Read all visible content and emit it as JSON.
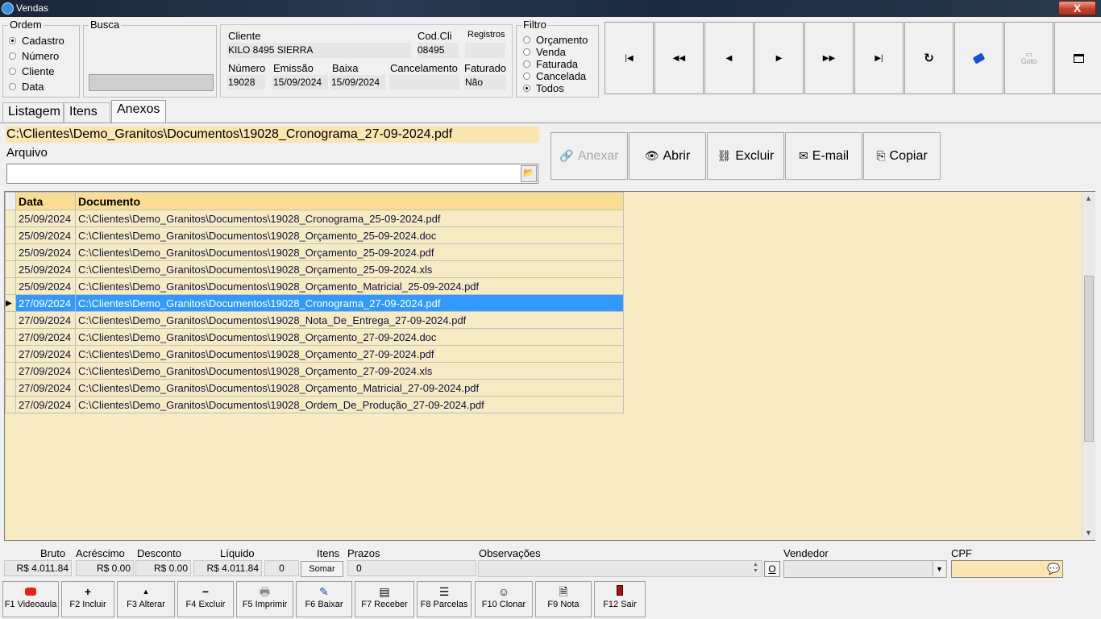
{
  "window": {
    "title": "Vendas",
    "close_label": "X"
  },
  "ordem": {
    "legend": "Ordem",
    "options": [
      {
        "label": "Cadastro",
        "checked": true
      },
      {
        "label": "Número",
        "checked": false
      },
      {
        "label": "Cliente",
        "checked": false
      },
      {
        "label": "Data",
        "checked": false
      }
    ]
  },
  "busca": {
    "legend": "Busca",
    "value": ""
  },
  "header": {
    "cliente_label": "Cliente",
    "cliente_value": "KILO 8495 SIERRA",
    "codcli_label": "Cod.Cli",
    "codcli_value": "08495",
    "registros_label": "Registros",
    "registros_value": "",
    "numero_label": "Número",
    "numero_value": "19028",
    "emissao_label": "Emissão",
    "emissao_value": "15/09/2024",
    "baixa_label": "Baixa",
    "baixa_value": "15/09/2024",
    "cancelamento_label": "Cancelamento",
    "cancelamento_value": "",
    "faturado_label": "Faturado",
    "faturado_value": "Não"
  },
  "filtro": {
    "legend": "Filtro",
    "options": [
      {
        "label": "Orçamento",
        "checked": false
      },
      {
        "label": "Venda",
        "checked": false
      },
      {
        "label": "Faturada",
        "checked": false
      },
      {
        "label": "Cancelada",
        "checked": false
      },
      {
        "label": "Todos",
        "checked": true
      }
    ]
  },
  "nav_buttons": [
    {
      "name": "first-record-button",
      "icon": "first-icon",
      "glyph": "⏮"
    },
    {
      "name": "prev-page-button",
      "icon": "rewind-icon",
      "glyph": "⏪"
    },
    {
      "name": "prev-record-button",
      "icon": "prev-icon",
      "glyph": "◀"
    },
    {
      "name": "next-record-button",
      "icon": "next-icon",
      "glyph": "▶"
    },
    {
      "name": "next-page-button",
      "icon": "fast-forward-icon",
      "glyph": "⏩"
    },
    {
      "name": "last-record-button",
      "icon": "last-icon",
      "glyph": "⏭"
    },
    {
      "name": "refresh-button",
      "icon": "refresh-icon",
      "glyph": "↻"
    },
    {
      "name": "tag-button",
      "icon": "tag-icon",
      "glyph": "🏷"
    },
    {
      "name": "goto-button",
      "icon": "goto-icon",
      "glyph": "Goto"
    },
    {
      "name": "form-view-button",
      "icon": "form-icon",
      "glyph": "▤"
    }
  ],
  "tabs": [
    {
      "label": "Listagem",
      "active": false
    },
    {
      "label": "Itens",
      "active": false
    },
    {
      "label": "Anexos",
      "active": true
    }
  ],
  "anexos": {
    "selected_path": "C:\\Clientes\\Demo_Granitos\\Documentos\\19028_Cronograma_27-09-2024.pdf",
    "arquivo_label": "Arquivo",
    "arquivo_value": "",
    "actions": [
      {
        "label": "Anexar",
        "icon": "paperclip-icon",
        "enabled": false
      },
      {
        "label": "Abrir",
        "icon": "eye-icon",
        "enabled": true
      },
      {
        "label": "Excluir",
        "icon": "delete-clip-icon",
        "enabled": true
      },
      {
        "label": "E-mail",
        "icon": "envelope-icon",
        "enabled": true
      },
      {
        "label": "Copiar",
        "icon": "copy-icon",
        "enabled": true
      }
    ]
  },
  "grid": {
    "columns": [
      "Data",
      "Documento"
    ],
    "rows": [
      {
        "data": "25/09/2024",
        "doc": "C:\\Clientes\\Demo_Granitos\\Documentos\\19028_Cronograma_25-09-2024.pdf",
        "selected": false
      },
      {
        "data": "25/09/2024",
        "doc": "C:\\Clientes\\Demo_Granitos\\Documentos\\19028_Orçamento_25-09-2024.doc",
        "selected": false
      },
      {
        "data": "25/09/2024",
        "doc": "C:\\Clientes\\Demo_Granitos\\Documentos\\19028_Orçamento_25-09-2024.pdf",
        "selected": false
      },
      {
        "data": "25/09/2024",
        "doc": "C:\\Clientes\\Demo_Granitos\\Documentos\\19028_Orçamento_25-09-2024.xls",
        "selected": false
      },
      {
        "data": "25/09/2024",
        "doc": "C:\\Clientes\\Demo_Granitos\\Documentos\\19028_Orçamento_Matricial_25-09-2024.pdf",
        "selected": false
      },
      {
        "data": "27/09/2024",
        "doc": "C:\\Clientes\\Demo_Granitos\\Documentos\\19028_Cronograma_27-09-2024.pdf",
        "selected": true
      },
      {
        "data": "27/09/2024",
        "doc": "C:\\Clientes\\Demo_Granitos\\Documentos\\19028_Nota_De_Entrega_27-09-2024.pdf",
        "selected": false
      },
      {
        "data": "27/09/2024",
        "doc": "C:\\Clientes\\Demo_Granitos\\Documentos\\19028_Orçamento_27-09-2024.doc",
        "selected": false
      },
      {
        "data": "27/09/2024",
        "doc": "C:\\Clientes\\Demo_Granitos\\Documentos\\19028_Orçamento_27-09-2024.pdf",
        "selected": false
      },
      {
        "data": "27/09/2024",
        "doc": "C:\\Clientes\\Demo_Granitos\\Documentos\\19028_Orçamento_27-09-2024.xls",
        "selected": false
      },
      {
        "data": "27/09/2024",
        "doc": "C:\\Clientes\\Demo_Granitos\\Documentos\\19028_Orçamento_Matricial_27-09-2024.pdf",
        "selected": false
      },
      {
        "data": "27/09/2024",
        "doc": "C:\\Clientes\\Demo_Granitos\\Documentos\\19028_Ordem_De_Produção_27-09-2024.pdf",
        "selected": false
      }
    ]
  },
  "totals": {
    "bruto_label": "Bruto",
    "bruto_value": "R$ 4.011.84",
    "acrescimo_label": "Acréscimo",
    "acrescimo_value": "R$ 0.00",
    "desconto_label": "Desconto",
    "desconto_value": "R$ 0.00",
    "liquido_label": "Líquido",
    "liquido_value": "R$ 4.011.84",
    "itens_label": "Itens",
    "itens_value": "0",
    "somar_label": "Somar",
    "prazos_label": "Prazos",
    "prazos_value": "0",
    "observacoes_label": "Observações",
    "observacoes_o": "O",
    "vendedor_label": "Vendedor",
    "vendedor_value": "",
    "cpf_label": "CPF",
    "cpf_value": ""
  },
  "function_keys": [
    {
      "label": "F1 Videoaula",
      "icon": "youtube-icon"
    },
    {
      "label": "F2 Incluir",
      "icon": "plus-icon"
    },
    {
      "label": "F3 Alterar",
      "icon": "up-arrow-icon"
    },
    {
      "label": "F4 Excluir",
      "icon": "minus-icon"
    },
    {
      "label": "F5 Imprimir",
      "icon": "printer-icon"
    },
    {
      "label": "F6 Baixar",
      "icon": "check-doc-icon"
    },
    {
      "label": "F7 Receber",
      "icon": "receipt-icon"
    },
    {
      "label": "F8 Parcelas",
      "icon": "list-icon"
    },
    {
      "label": "F10 Clonar",
      "icon": "clone-icon"
    },
    {
      "label": "F9 Nota",
      "icon": "note-icon"
    },
    {
      "label": "F12 Sair",
      "icon": "exit-icon"
    }
  ],
  "colors": {
    "grid_bg": "#f6ebc3",
    "grid_header": "#f9dd92",
    "selection": "#3399ff",
    "path_highlight": "#fbe5b0"
  }
}
